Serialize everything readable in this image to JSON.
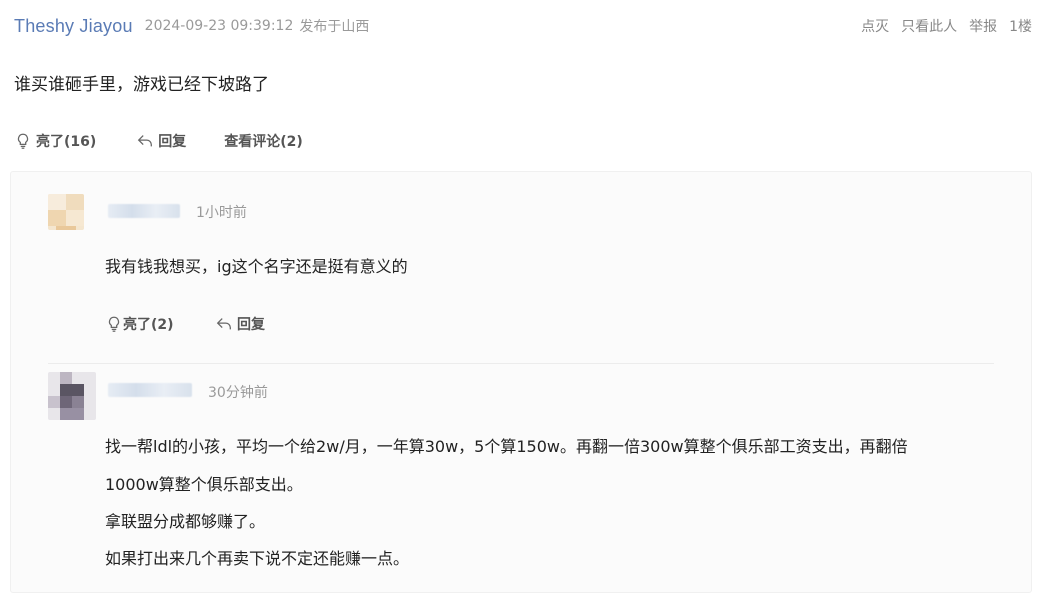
{
  "post": {
    "username": "Theshy  Jiayou",
    "timestamp": "2024-09-23 09:39:12",
    "location": "发布于山西",
    "actions": [
      "点灭",
      "只看此人",
      "举报",
      "1楼"
    ],
    "content": "谁买谁砸手里，游戏已经下坡路了",
    "light_label": "亮了(16)",
    "reply_label": "回复",
    "view_comments_label": "查看评论(2)"
  },
  "comments": [
    {
      "time": "1小时前",
      "content_lines": [
        "我有钱我想买，ig这个名字还是挺有意义的"
      ],
      "light_label": "亮了(2)",
      "reply_label": "回复"
    },
    {
      "time": "30分钟前",
      "content_lines": [
        "找一帮ldl的小孩，平均一个给2w/月，一年算30w，5个算150w。再翻一倍300w算整个俱乐部工资支出，再翻倍",
        "1000w算整个俱乐部支出。",
        "拿联盟分成都够赚了。",
        "如果打出来几个再卖下说不定还能赚一点。"
      ]
    }
  ],
  "colors": {
    "username": "#5a7bb5",
    "meta": "#9a9a9a",
    "comment_bg": "#fbfbfb"
  },
  "icons": [
    "lightbulb-icon",
    "reply-arrow-icon"
  ]
}
